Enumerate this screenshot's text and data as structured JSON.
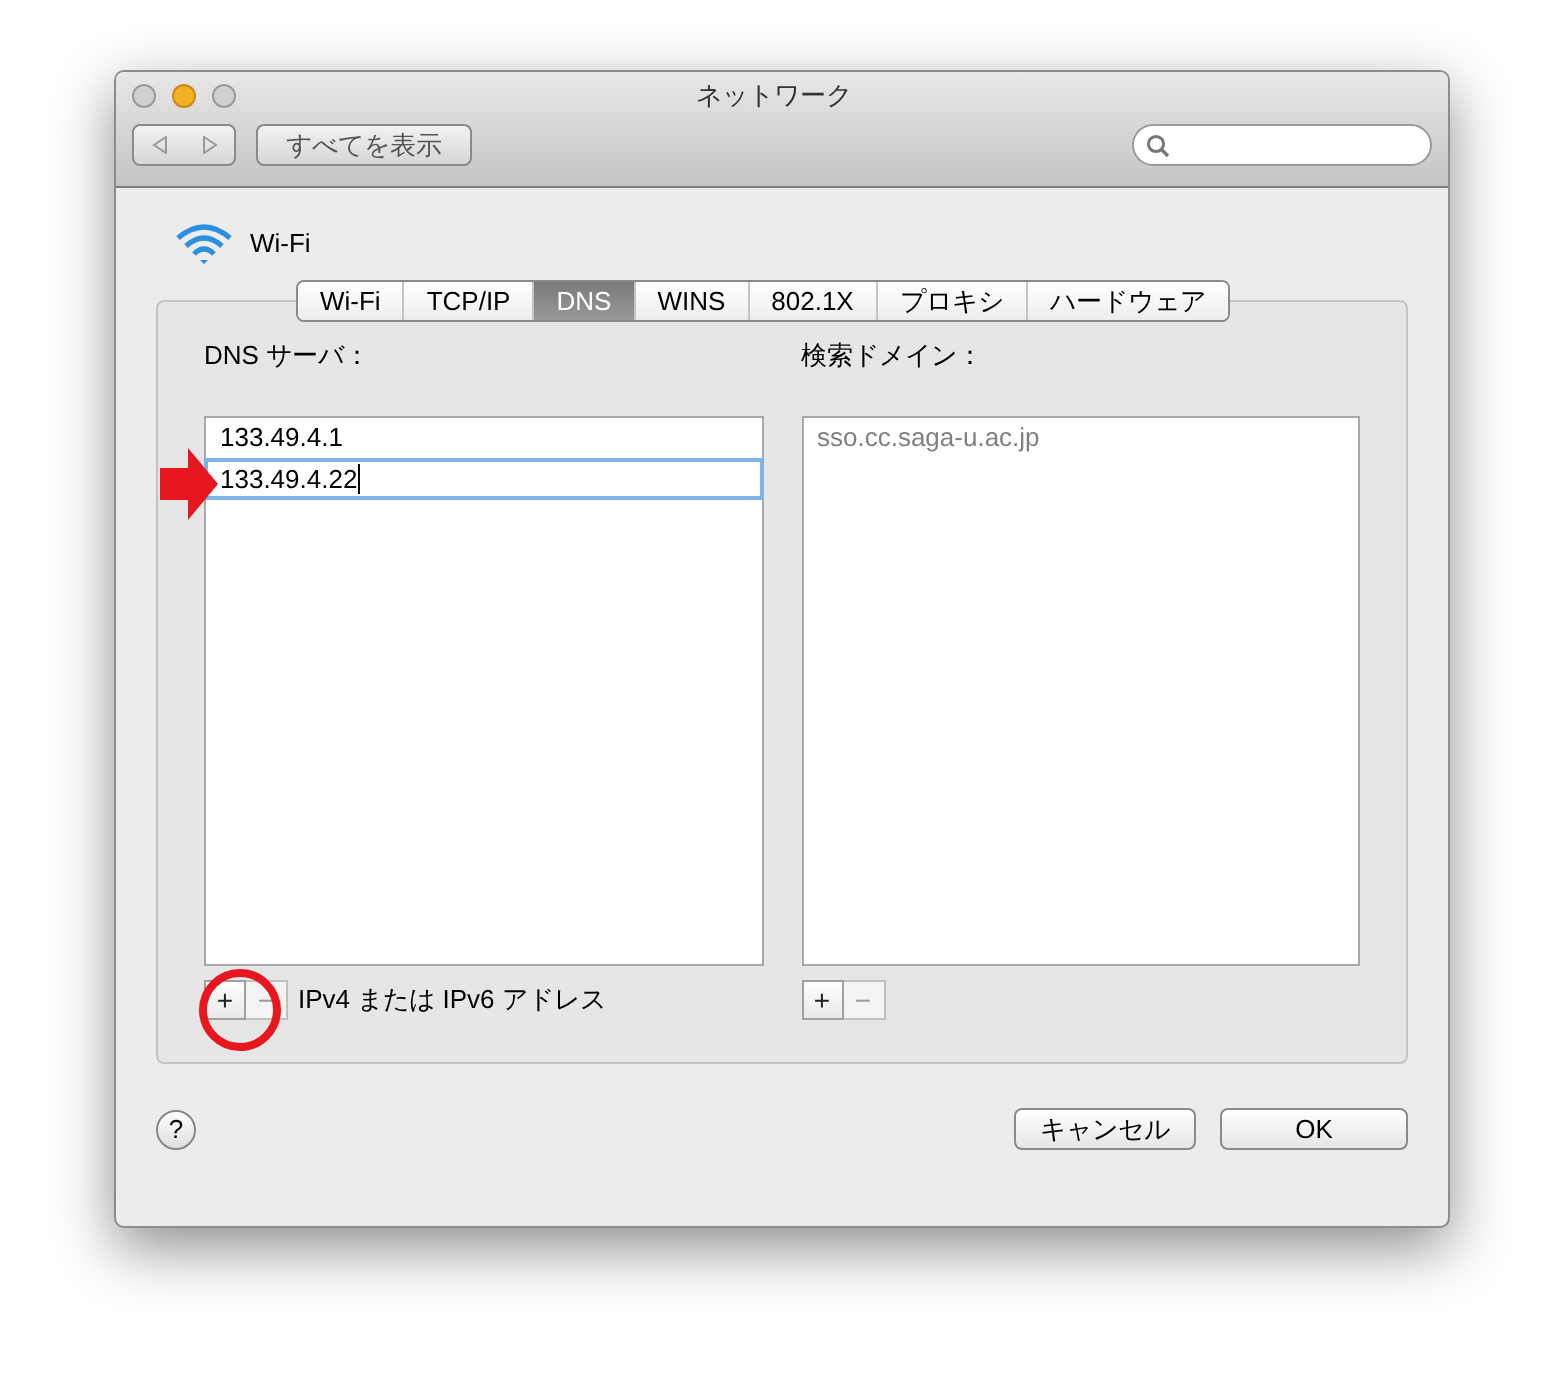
{
  "window": {
    "title": "ネットワーク"
  },
  "toolbar": {
    "show_all": "すべてを表示"
  },
  "service": {
    "name": "Wi-Fi"
  },
  "tabs": [
    {
      "label": "Wi-Fi",
      "selected": false
    },
    {
      "label": "TCP/IP",
      "selected": false
    },
    {
      "label": "DNS",
      "selected": true
    },
    {
      "label": "WINS",
      "selected": false
    },
    {
      "label": "802.1X",
      "selected": false
    },
    {
      "label": "プロキシ",
      "selected": false
    },
    {
      "label": "ハードウェア",
      "selected": false
    }
  ],
  "dns_servers": {
    "label": "DNS サーバ：",
    "entries": [
      {
        "value": "133.49.4.1",
        "editing": false
      },
      {
        "value": "133.49.4.22",
        "editing": true
      }
    ],
    "add": "+",
    "remove": "−",
    "hint": "IPv4 または IPv6 アドレス"
  },
  "search_domains": {
    "label": "検索ドメイン：",
    "entries": [
      {
        "value": "sso.cc.saga-u.ac.jp",
        "editing": false
      }
    ],
    "add": "+",
    "remove": "−"
  },
  "help": "?",
  "buttons": [
    {
      "label": "キャンセル",
      "kind": "cancel"
    },
    {
      "label": "OK",
      "kind": "ok"
    }
  ]
}
